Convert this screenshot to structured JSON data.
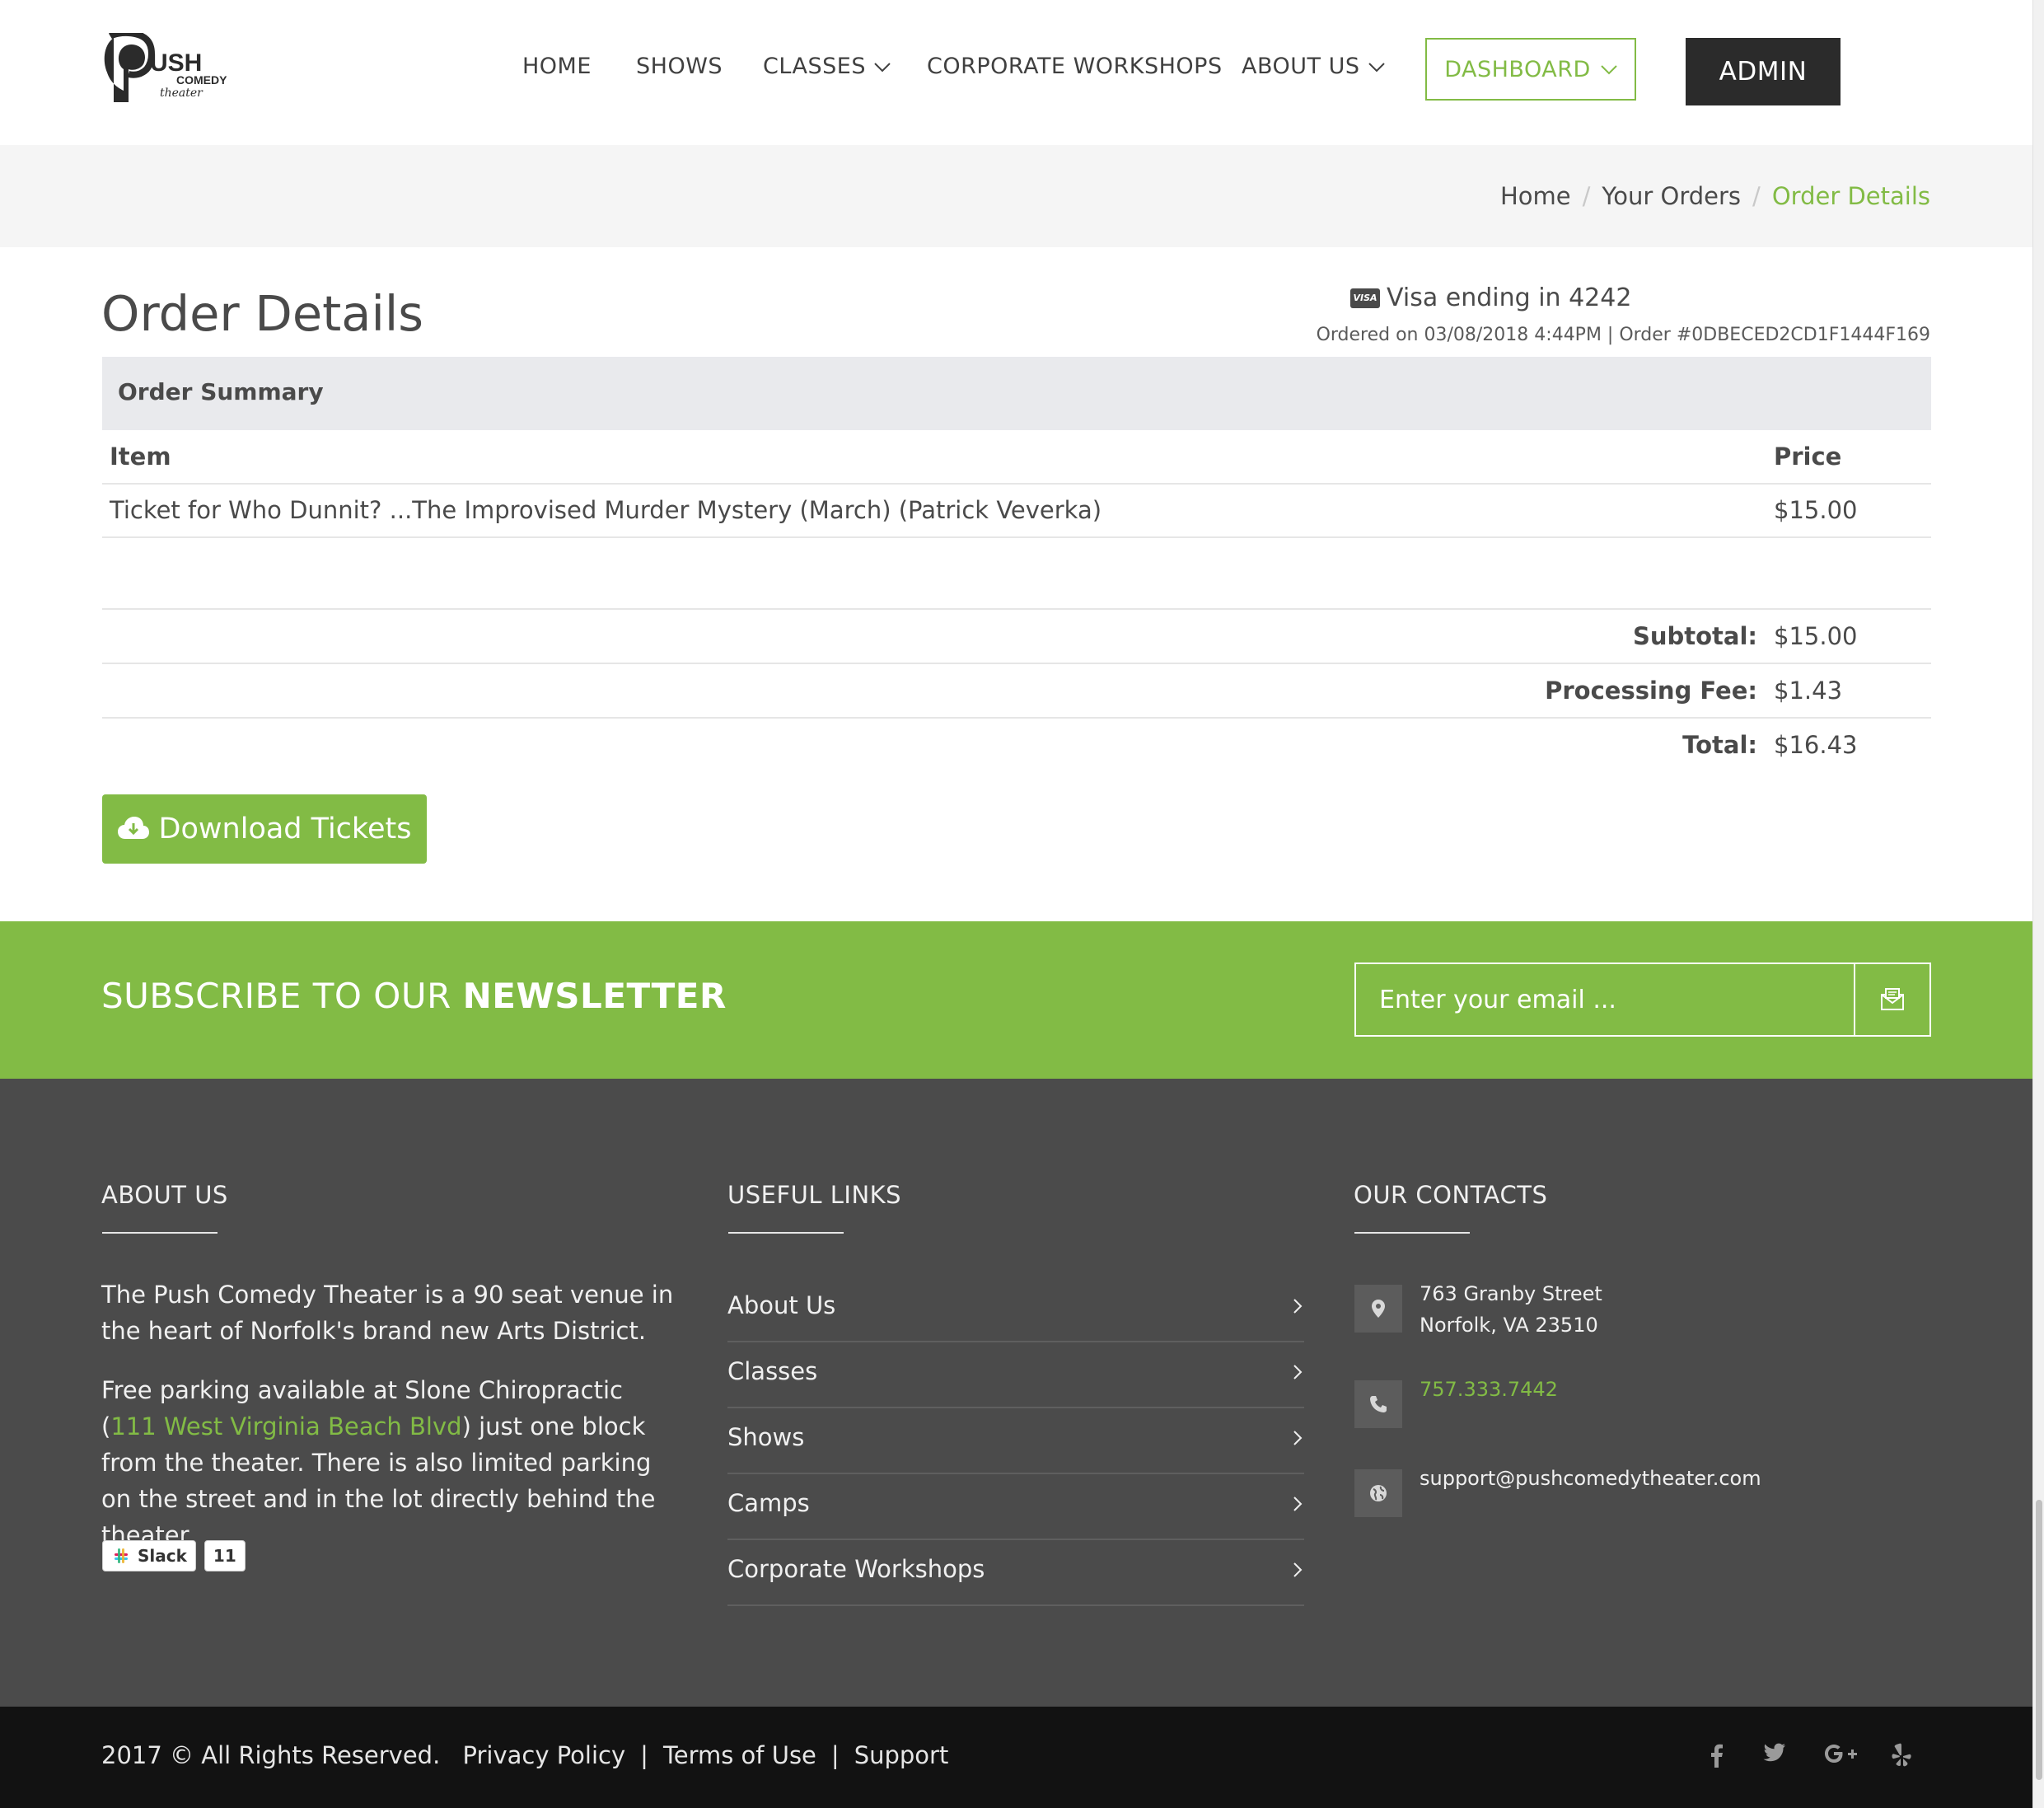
{
  "brand": {
    "logo_main": "USH",
    "logo_sub": "COMEDY",
    "logo_script": "theater"
  },
  "nav": {
    "items": [
      "HOME",
      "SHOWS",
      "CLASSES",
      "CORPORATE WORKSHOPS",
      "ABOUT US"
    ],
    "dashboard": "DASHBOARD",
    "admin": "ADMIN"
  },
  "breadcrumb": [
    "Home",
    "Your Orders",
    "Order Details"
  ],
  "order": {
    "title": "Order Details",
    "payment": "Visa ending in 4242",
    "visa_badge": "VISA",
    "ordered_line": "Ordered on 03/08/2018 4:44PM | Order #0DBECED2CD1F1444F169",
    "summary_heading": "Order Summary",
    "columns": [
      "Item",
      "Price"
    ],
    "items": [
      {
        "item": "Ticket for Who Dunnit? ...The Improvised Murder Mystery (March) (Patrick Veverka)",
        "price": "$15.00"
      }
    ],
    "totals": [
      {
        "label": "Subtotal:",
        "value": "$15.00"
      },
      {
        "label": "Processing Fee:",
        "value": "$1.43"
      },
      {
        "label": "Total:",
        "value": "$16.43"
      }
    ],
    "download_label": "Download Tickets"
  },
  "newsletter": {
    "title_light": "SUBSCRIBE TO OUR ",
    "title_bold": "NEWSLETTER",
    "placeholder": "Enter your email ..."
  },
  "footer": {
    "about": {
      "title": "ABOUT US",
      "para1": "The Push Comedy Theater is a 90 seat venue in the heart of Norfolk's brand new Arts District.",
      "para2_pre": "Free parking available at Slone Chiropractic (",
      "para2_link": "111 West Virginia Beach Blvd",
      "para2_post": ") just one block from the theater. There is also limited parking on the street and in the lot directly behind the theater.",
      "slack_label": "Slack",
      "slack_count": "11"
    },
    "links": {
      "title": "USEFUL LINKS",
      "items": [
        "About Us",
        "Classes",
        "Shows",
        "Camps",
        "Corporate Workshops"
      ]
    },
    "contacts": {
      "title": "OUR CONTACTS",
      "address_line1": "763 Granby Street",
      "address_line2": "Norfolk, VA 23510",
      "phone": "757.333.7442",
      "email": "support@pushcomedytheater.com"
    }
  },
  "bottom": {
    "copyright": "2017 © All Rights Reserved.",
    "links": [
      "Privacy Policy",
      "Terms of Use",
      "Support"
    ],
    "separator": "|",
    "social_icons": [
      "facebook-icon",
      "twitter-icon",
      "google-plus-icon",
      "yelp-icon"
    ]
  },
  "colors": {
    "accent": "#82bb45",
    "dark": "#2b2b2b",
    "footer": "#4b4b4b",
    "bottom": "#121212"
  }
}
